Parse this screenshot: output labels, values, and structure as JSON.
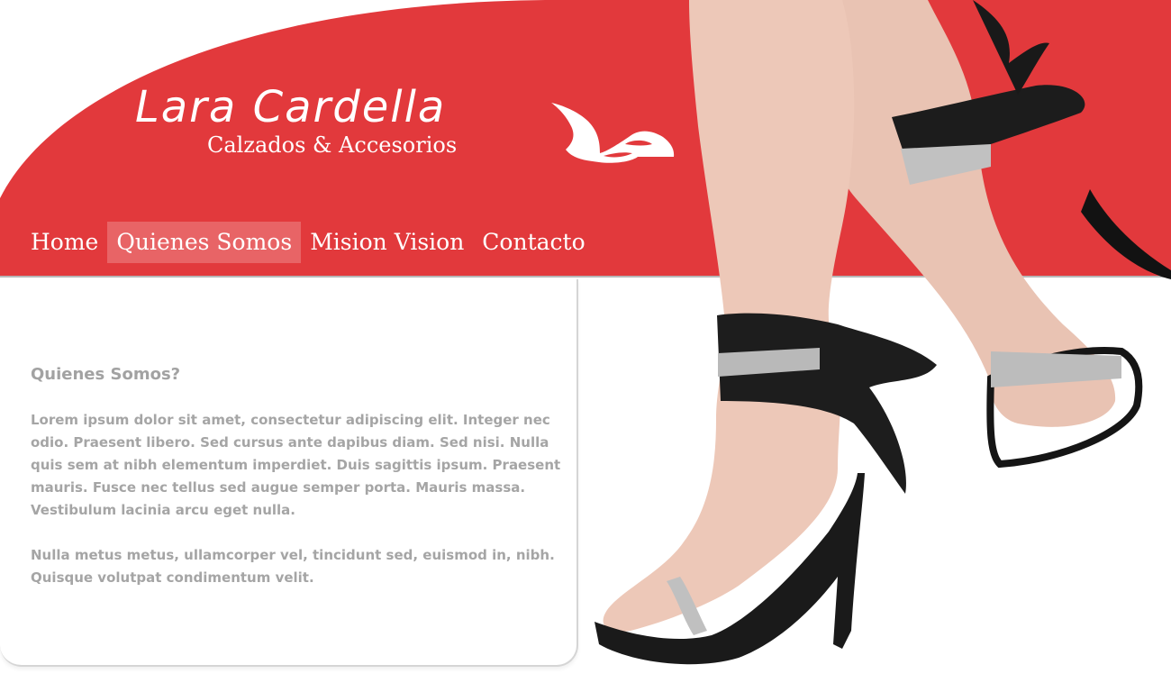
{
  "brand": {
    "name": "Lara Cardella",
    "tagline": "Calzados & Accesorios",
    "logo_icon": "shoe-logo-icon"
  },
  "nav": {
    "items": [
      {
        "label": "Home",
        "active": false
      },
      {
        "label": "Quienes Somos",
        "active": true
      },
      {
        "label": "Mision Vision",
        "active": false
      },
      {
        "label": "Contacto",
        "active": false
      }
    ]
  },
  "content": {
    "title": "Quienes Somos?",
    "paragraphs": [
      "Lorem ipsum dolor sit amet, consectetur adipiscing elit. Integer nec odio. Praesent libero. Sed cursus ante dapibus diam. Sed nisi. Nulla quis sem at nibh elementum imperdiet. Duis sagittis ipsum. Praesent mauris. Fusce nec tellus sed augue semper porta. Mauris massa. Vestibulum lacinia arcu eget nulla.",
      "Nulla metus metus, ullamcorper vel, tincidunt sed, euismod in, nibh. Quisque volutpat condimentum velit."
    ]
  },
  "hero": {
    "image": "legs-high-heels-illustration"
  },
  "colors": {
    "brand_red": "#e2393c",
    "text_gray": "#a5a5a5",
    "white": "#ffffff"
  }
}
